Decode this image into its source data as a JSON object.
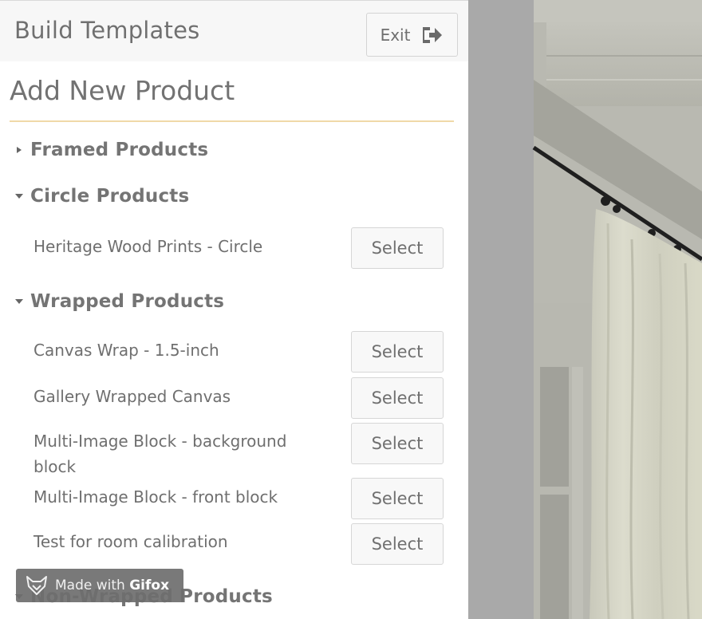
{
  "header": {
    "title": "Build Templates",
    "exit_label": "Exit"
  },
  "heading": "Add New Product",
  "categories": [
    {
      "label": "Framed Products",
      "expanded": false
    },
    {
      "label": "Circle Products",
      "expanded": true,
      "items": [
        "Heritage Wood Prints - Circle"
      ]
    },
    {
      "label": "Wrapped Products",
      "expanded": true,
      "items": [
        "Canvas Wrap - 1.5-inch",
        "Gallery Wrapped Canvas",
        "Multi-Image Block - background block",
        "Multi-Image Block - front block",
        "Test for room calibration"
      ]
    },
    {
      "label": "Non-Wrapped Products",
      "expanded": true
    }
  ],
  "select_label": "Select",
  "watermark": {
    "prefix": "Made with",
    "brand": "Gifox"
  },
  "colors": {
    "accent_rule": "#f0d9a8",
    "overlay": "#a9a9a9"
  }
}
